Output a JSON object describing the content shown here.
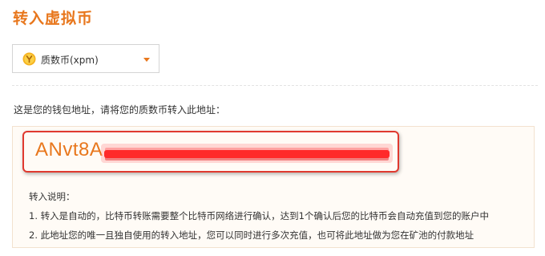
{
  "page": {
    "title": "转入虚拟币"
  },
  "currency_select": {
    "selected": "质数币(xpm)",
    "icon": "xpm-coin-icon"
  },
  "deposit": {
    "instruction": "这是您的钱包地址，请将您的质数币转入此地址：",
    "address_visible": "ANvt8A",
    "redaction_color": "#ff2a2a"
  },
  "notes": {
    "title": "转入说明：",
    "items": [
      "1. 转入是自动的，比特币转账需要整个比特币网络进行确认，达到1个确认后您的比特币会自动充值到您的账户中",
      "2. 此地址您的唯一且独自使用的转入地址，您可以同时进行多次充值，也可将此地址做为您在矿池的付款地址"
    ]
  },
  "colors": {
    "accent": "#e8771d",
    "highlight_border": "#e0392f",
    "box_background": "#fffbf6"
  }
}
